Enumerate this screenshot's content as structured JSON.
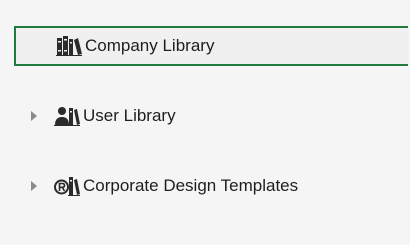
{
  "library_tree": {
    "items": [
      {
        "label": "Company Library",
        "icon": "books-icon",
        "selected": true,
        "has_expander": false
      },
      {
        "label": "User Library",
        "icon": "user-books-icon",
        "selected": false,
        "has_expander": true
      },
      {
        "label": "Corporate Design Templates",
        "icon": "registered-book-icon",
        "selected": false,
        "has_expander": true
      }
    ],
    "colors": {
      "background": "#f5f5f5",
      "selection_border": "#1f7a3e",
      "text": "#1e1e1e",
      "expander_arrow": "#8a8a8a"
    }
  }
}
